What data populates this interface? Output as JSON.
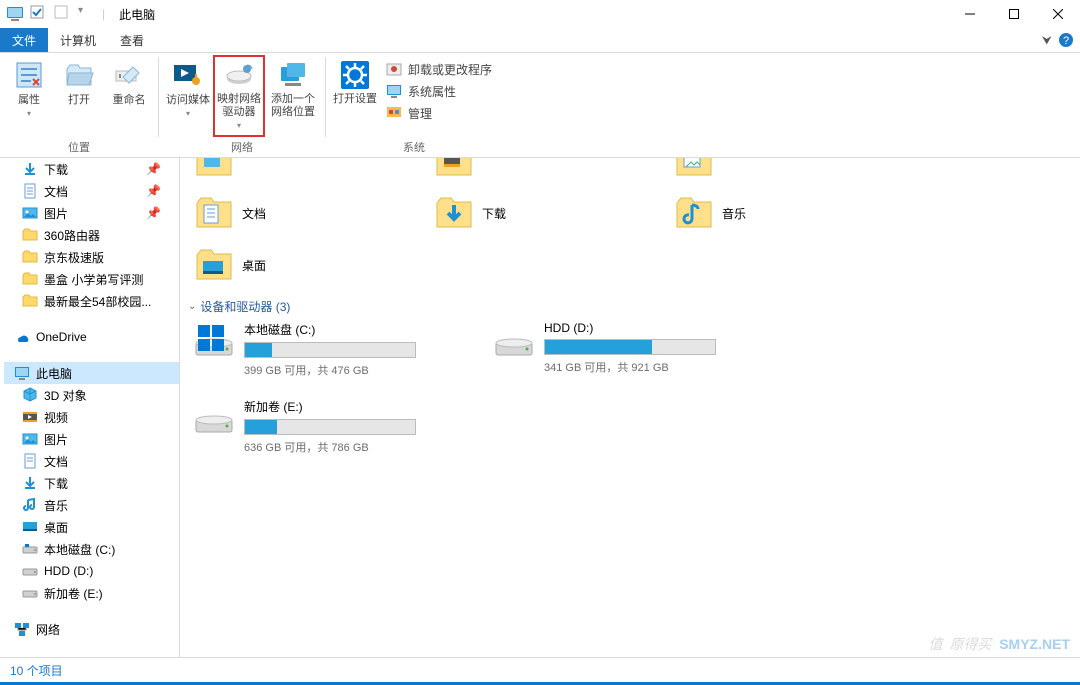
{
  "window": {
    "title": "此电脑"
  },
  "tabs": {
    "file": "文件",
    "computer": "计算机",
    "view": "查看"
  },
  "ribbon": {
    "location": {
      "label": "位置",
      "properties": "属性",
      "open": "打开",
      "rename": "重命名"
    },
    "network": {
      "label": "网络",
      "access_media": "访问媒体",
      "map_network_drive": "映射网络驱动器",
      "add_network_location": "添加一个网络位置"
    },
    "system": {
      "label": "系统",
      "open_settings": "打开设置",
      "uninstall": "卸载或更改程序",
      "system_properties": "系统属性",
      "manage": "管理"
    }
  },
  "nav": {
    "downloads": "下载",
    "documents": "文档",
    "pictures": "图片",
    "router360": "360路由器",
    "jd_express": "京东极速版",
    "mohe": "墨盒 小学弟写评测",
    "newest54": "最新最全54部校园...",
    "onedrive": "OneDrive",
    "this_pc": "此电脑",
    "objects3d": "3D 对象",
    "videos": "视频",
    "pictures2": "图片",
    "documents2": "文档",
    "downloads2": "下载",
    "music": "音乐",
    "desktop": "桌面",
    "local_c": "本地磁盘 (C:)",
    "hdd_d": "HDD (D:)",
    "new_e": "新加卷 (E:)",
    "network": "网络"
  },
  "content": {
    "folders": {
      "documents": "文档",
      "downloads": "下载",
      "music": "音乐",
      "desktop": "桌面"
    },
    "section_drives": "设备和驱动器 (3)",
    "drives": [
      {
        "name": "本地磁盘 (C:)",
        "meta": "399 GB 可用，共 476 GB",
        "used_pct": 16
      },
      {
        "name": "HDD (D:)",
        "meta": "341 GB 可用，共 921 GB",
        "used_pct": 63
      },
      {
        "name": "新加卷 (E:)",
        "meta": "636 GB 可用，共 786 GB",
        "used_pct": 19
      }
    ]
  },
  "status": {
    "items": "10 个项目"
  },
  "watermark": {
    "text": "值",
    "suffix2": "原",
    "suffix3": "得买",
    "brand": "SMYZ.NET"
  }
}
